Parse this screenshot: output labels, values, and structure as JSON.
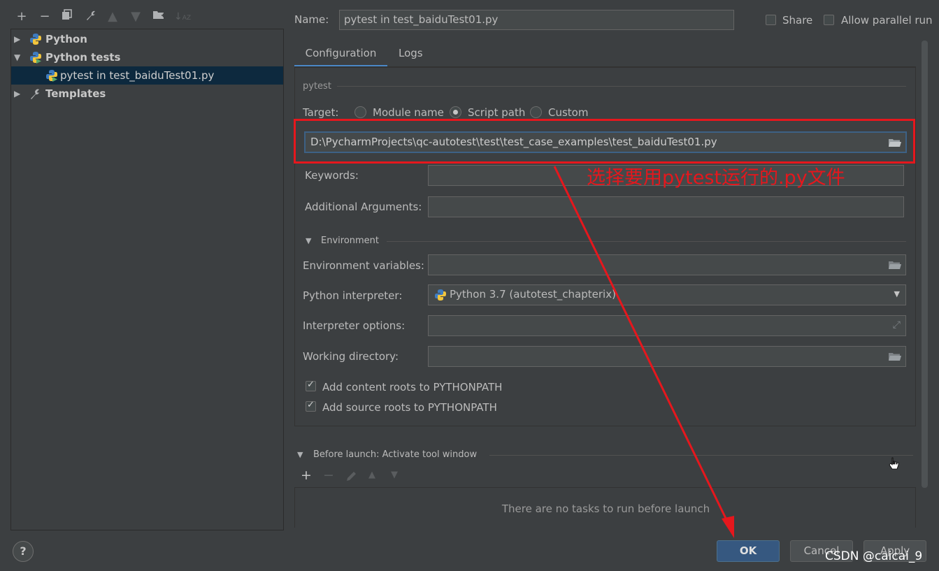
{
  "toolbar": {
    "icons": [
      "plus-icon",
      "minus-icon",
      "copy-icon",
      "wrench-icon",
      "arrow-up-icon",
      "arrow-down-icon",
      "folder-add-icon",
      "sort-icon"
    ]
  },
  "tree": {
    "items": [
      {
        "label": "Python",
        "expanded": false
      },
      {
        "label": "Python tests",
        "expanded": true
      },
      {
        "label": "pytest in test_baiduTest01.py",
        "selected": true
      },
      {
        "label": "Templates",
        "expanded": false
      }
    ]
  },
  "header": {
    "name_label": "Name:",
    "name_value": "pytest in test_baiduTest01.py",
    "share_label": "Share",
    "share_checked": false,
    "parallel_label": "Allow parallel run",
    "parallel_checked": false
  },
  "tabs": [
    {
      "label": "Configuration",
      "active": true
    },
    {
      "label": "Logs",
      "active": false
    }
  ],
  "config": {
    "section_title": "pytest",
    "target_label": "Target:",
    "target_options": [
      "Module name",
      "Script path",
      "Custom"
    ],
    "target_selected": "Script path",
    "script_path": "D:\\PycharmProjects\\qc-autotest\\test\\test_case_examples\\test_baiduTest01.py",
    "keywords_label": "Keywords:",
    "keywords_value": "",
    "additional_args_label": "Additional Arguments:",
    "additional_args_value": "",
    "environment_section": "Environment",
    "env_vars_label": "Environment variables:",
    "env_vars_value": "",
    "interpreter_label": "Python interpreter:",
    "interpreter_value": "Python 3.7 (autotest_chapterix)",
    "interpreter_options_label": "Interpreter options:",
    "interpreter_options_value": "",
    "working_dir_label": "Working directory:",
    "working_dir_value": "",
    "add_content_roots_label": "Add content roots to PYTHONPATH",
    "add_content_roots_checked": true,
    "add_source_roots_label": "Add source roots to PYTHONPATH",
    "add_source_roots_checked": true
  },
  "before_launch": {
    "title": "Before launch: Activate tool window",
    "empty_text": "There are no tasks to run before launch"
  },
  "buttons": {
    "ok": "OK",
    "cancel": "Cancel",
    "apply": "Apply",
    "help": "?"
  },
  "annotation": {
    "text": "选择要用pytest运行的.py文件",
    "color": "#e5171d"
  },
  "watermark": "CSDN @caicai_9",
  "colors": {
    "background": "#3c3f41",
    "selection": "#0d293e",
    "ok_button": "#365880",
    "accent_underline": "#4a88c7"
  }
}
